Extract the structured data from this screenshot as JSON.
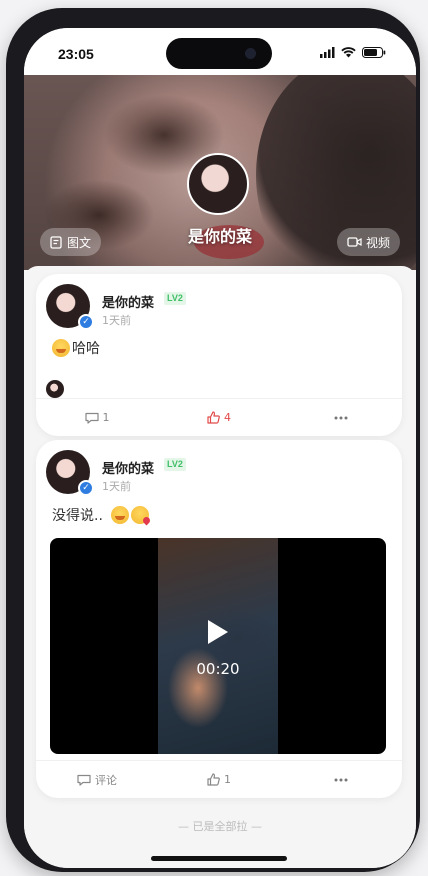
{
  "status_bar": {
    "time": "23:05"
  },
  "cover": {
    "name": "是你的菜",
    "left_button": "图文",
    "right_button": "视频"
  },
  "posts": [
    {
      "username": "是你的菜",
      "level": "LV2",
      "time": "1天前",
      "text": "哈哈",
      "emojis": [
        "shy-emoji"
      ],
      "actions": {
        "comments": "1",
        "likes": "4"
      }
    },
    {
      "username": "是你的菜",
      "level": "LV2",
      "time": "1天前",
      "text": "没得说..",
      "emojis": [
        "shy-emoji",
        "kiss-emoji"
      ],
      "video": {
        "duration": "00:20"
      },
      "actions": {
        "comments": "评论",
        "likes": "1"
      }
    }
  ],
  "footer": "— 已是全部拉 —",
  "colors": {
    "liked": "#e24a4a",
    "level_badge": "#3fbf68",
    "verified": "#2f7de1"
  }
}
